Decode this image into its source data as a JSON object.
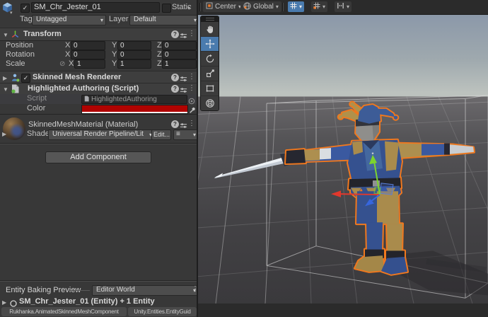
{
  "icons": {
    "foldout_open": "▼",
    "foldout_closed": "▶",
    "dropdown_arrow": "▾",
    "check": "✓",
    "kebab": "⋮",
    "help": "?",
    "hamburger": "≡",
    "link": "⊘"
  },
  "inspector": {
    "gameobject": {
      "name": "SM_Chr_Jester_01",
      "static_label": "Static"
    },
    "tag_layer": {
      "tag_label": "Tag",
      "tag_value": "Untagged",
      "layer_label": "Layer",
      "layer_value": "Default"
    },
    "transform": {
      "title": "Transform",
      "axis": {
        "x": "X",
        "y": "Y",
        "z": "Z"
      },
      "rows": [
        {
          "label": "Position",
          "x": "0",
          "y": "0",
          "z": "0"
        },
        {
          "label": "Rotation",
          "x": "0",
          "y": "0",
          "z": "0"
        },
        {
          "label": "Scale",
          "x": "1",
          "y": "1",
          "z": "1"
        }
      ]
    },
    "skinned_mesh_renderer": {
      "title": "Skinned Mesh Renderer"
    },
    "highlighted_authoring": {
      "title": "Highlighted Authoring (Script)",
      "script_label": "Script",
      "script_value": "HighlightedAuthoring",
      "color_label": "Color",
      "color_hex": "#b00301"
    },
    "material": {
      "title": "SkinnedMeshMaterial (Material)",
      "shader_label": "Shader",
      "shader_value": "Universal Render Pipeline/Lit",
      "edit_button": "Edit..."
    },
    "add_component_button": "Add Component",
    "entity_baking": {
      "title": "Entity Baking Preview",
      "world_value": "Editor World",
      "entity_summary": "SM_Chr_Jester_01 (Entity) + 1 Entity",
      "chips": [
        "Rukhanka.AnimatedSkinnedMeshComponent",
        "Unity.Entities.EntityGuid"
      ]
    }
  },
  "scene": {
    "toolbar": {
      "pivot_label": "Center",
      "orientation_label": "Global"
    },
    "colors": {
      "selection_outline": "#f0781e",
      "gizmo_x": "#e2382c",
      "gizmo_y": "#7cd42e",
      "gizmo_z": "#3766de",
      "tool_selected": "#4a7bae"
    }
  }
}
